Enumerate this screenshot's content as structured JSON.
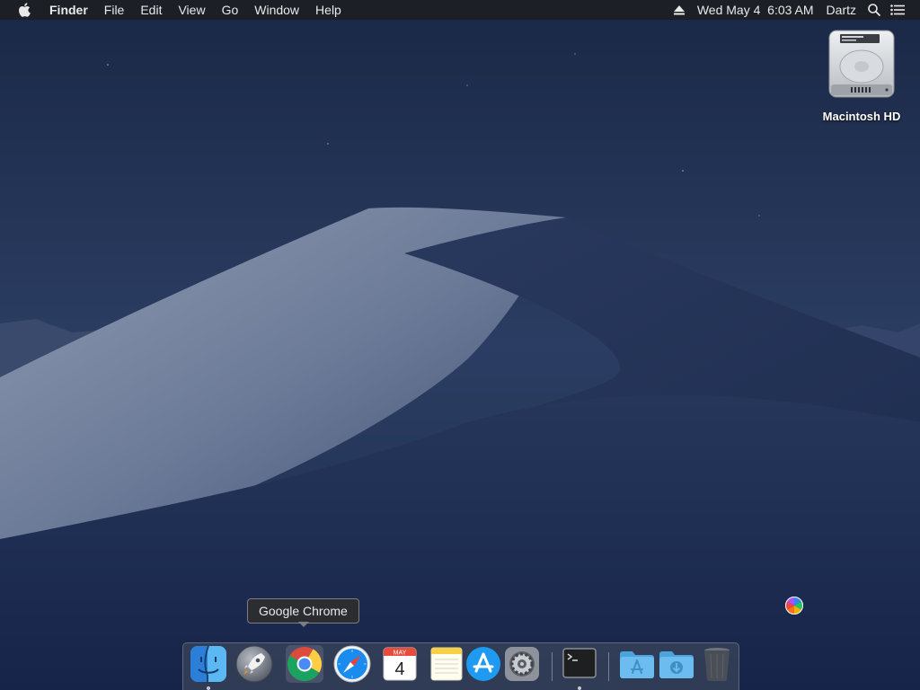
{
  "menubar": {
    "apple_icon": "apple-logo-icon",
    "app_name": "Finder",
    "menus": [
      "File",
      "Edit",
      "View",
      "Go",
      "Window",
      "Help"
    ],
    "status": {
      "eject_icon": "eject-icon",
      "clock": "Wed May 4  6:03 AM",
      "user": "Dartz",
      "search_icon": "spotlight-search-icon",
      "notification_icon": "notification-center-icon"
    }
  },
  "desktop": {
    "drive_label": "Macintosh HD",
    "drive_icon": "hard-drive-icon",
    "cursor": "busy-spinner-icon"
  },
  "dock": {
    "tooltip": "Google Chrome",
    "calendar_month": "MAY",
    "calendar_day": "4",
    "apps": [
      {
        "icon": "finder-icon",
        "running": true
      },
      {
        "icon": "launchpad-icon",
        "running": false
      },
      {
        "icon": "chrome-icon",
        "running": false
      },
      {
        "icon": "safari-icon",
        "running": false
      },
      {
        "icon": "calendar-icon",
        "running": false
      },
      {
        "icon": "notes-icon",
        "running": false
      },
      {
        "icon": "app-store-icon",
        "running": false
      },
      {
        "icon": "system-preferences-icon",
        "running": false
      },
      {
        "icon": "terminal-icon",
        "running": true
      },
      {
        "icon": "applications-folder-icon",
        "running": false
      },
      {
        "icon": "downloads-folder-icon",
        "running": false
      },
      {
        "icon": "trash-icon",
        "running": false
      }
    ]
  }
}
